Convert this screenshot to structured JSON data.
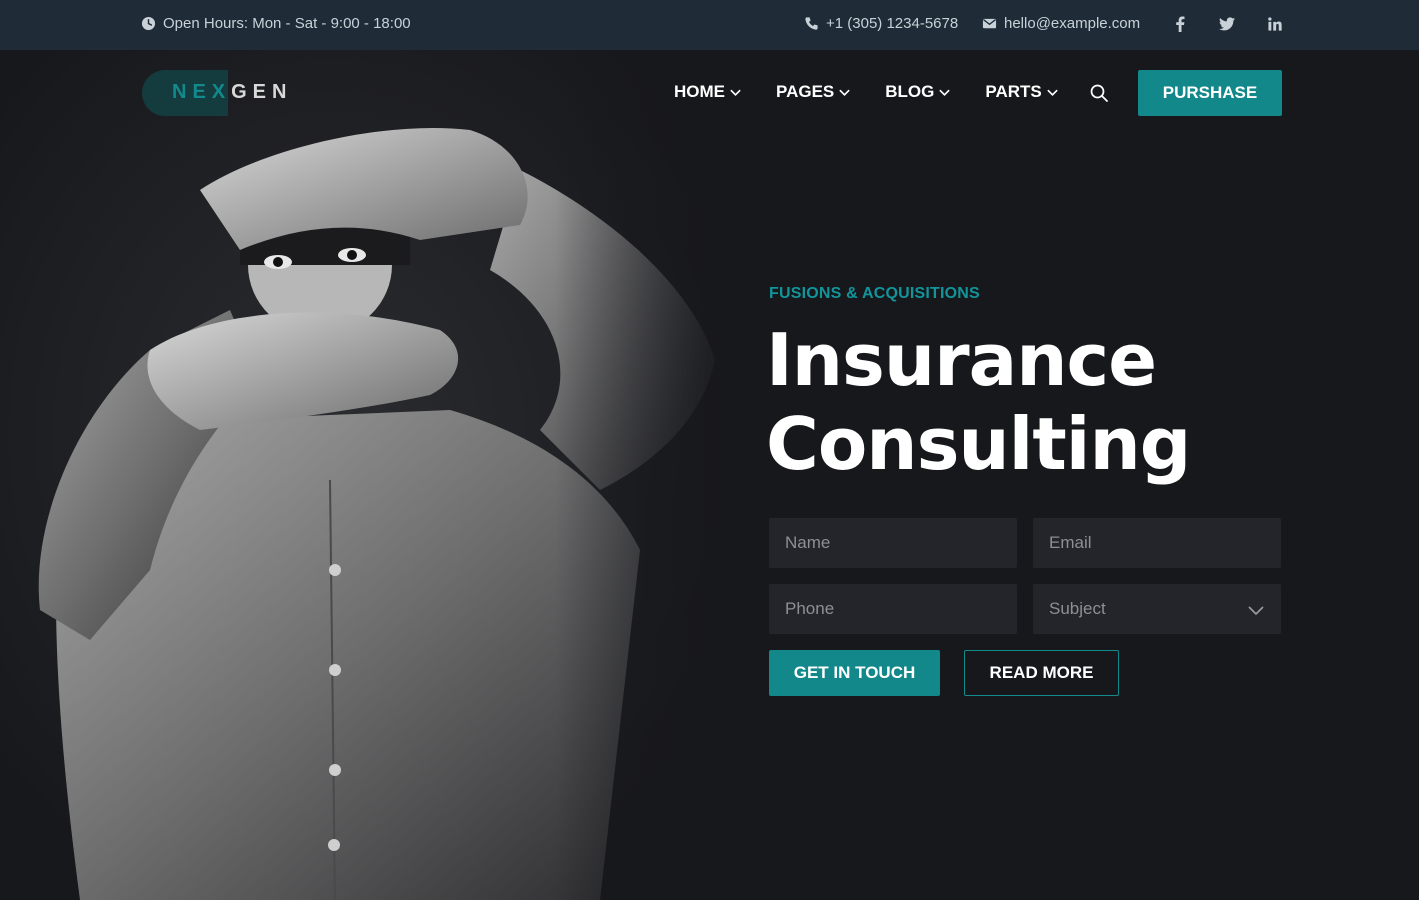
{
  "topbar": {
    "hours": "Open Hours: Mon - Sat - 9:00 - 18:00",
    "phone": "+1 (305) 1234-5678",
    "email": "hello@example.com",
    "social": [
      "facebook-icon",
      "twitter-icon",
      "linkedin-icon"
    ]
  },
  "logo": {
    "part1": "NEX",
    "part2": "GEN"
  },
  "nav": {
    "items": [
      {
        "label": "HOME"
      },
      {
        "label": "PAGES"
      },
      {
        "label": "BLOG"
      },
      {
        "label": "PARTS"
      }
    ],
    "purchase_label": "PURSHASE"
  },
  "hero": {
    "eyebrow": "FUSIONS & ACQUISITIONS",
    "title_line1": "Insurance",
    "title_line2": "Consulting"
  },
  "form": {
    "name_placeholder": "Name",
    "email_placeholder": "Email",
    "phone_placeholder": "Phone",
    "subject_value": "Subject"
  },
  "buttons": {
    "primary": "GET IN TOUCH",
    "secondary": "READ MORE"
  },
  "colors": {
    "accent": "#12888a",
    "topbar_bg": "#1f2b36",
    "page_bg": "#17181c"
  }
}
